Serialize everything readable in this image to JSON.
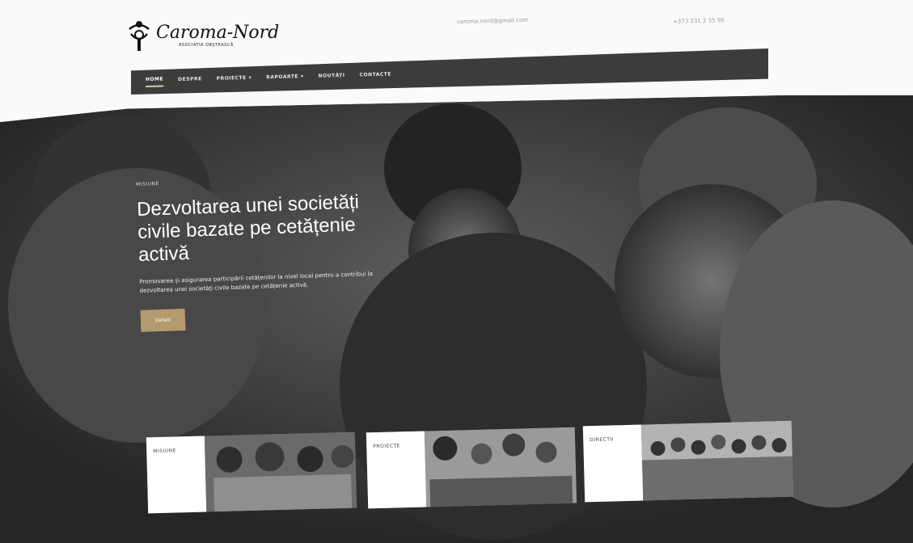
{
  "logo": {
    "title": "Caroma-Nord",
    "subtitle": "ASOCIAȚIA OBȘTEASCĂ"
  },
  "header": {
    "contact_left": "caroma.nord@gmail.com",
    "contact_right": "+373 231 2 35 95"
  },
  "nav": {
    "items": [
      {
        "label": "HOME",
        "active": true,
        "dropdown": false
      },
      {
        "label": "DESPRE",
        "active": false,
        "dropdown": false
      },
      {
        "label": "PROIECTE",
        "active": false,
        "dropdown": true
      },
      {
        "label": "RAPOARTE",
        "active": false,
        "dropdown": true
      },
      {
        "label": "NOUTĂȚI",
        "active": false,
        "dropdown": false
      },
      {
        "label": "CONTACTE",
        "active": false,
        "dropdown": false
      }
    ]
  },
  "hero": {
    "eyebrow": "MISIUNE",
    "headline": "Dezvoltarea unei societăți civile bazate pe cetățenie activă",
    "lead": "Promovarea și asigurarea participării cetățenilor la nivel local pentru a contribui la dezvoltarea unei societăți civile bazate pe cetățenie activă.",
    "cta_label": "Detalii"
  },
  "cards": [
    {
      "label": "MISIUNE"
    },
    {
      "label": "PROIECTE"
    },
    {
      "label": "DIRECTII"
    }
  ],
  "colors": {
    "nav_bg": "#3c3c3c",
    "accent": "#b59a70",
    "hero_overlay": "#4b4b4b"
  }
}
